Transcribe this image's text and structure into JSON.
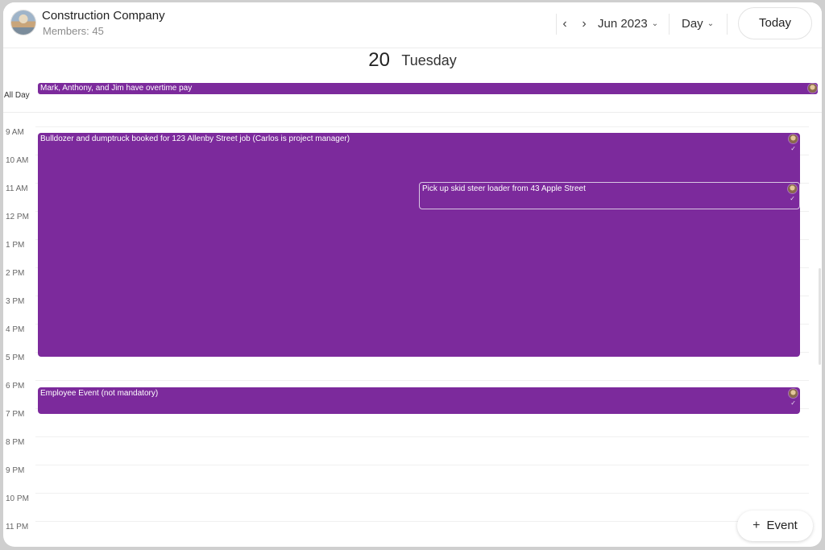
{
  "group": {
    "name": "Construction Company",
    "members": "Members: 45"
  },
  "nav": {
    "prev_icon": "chevron-left-icon",
    "next_icon": "chevron-right-icon",
    "month": "Jun 2023",
    "view": "Day",
    "today": "Today"
  },
  "day": {
    "number": "20",
    "name": "Tuesday"
  },
  "allday": {
    "label": "All Day",
    "event": "Mark, Anthony, and Jim have overtime pay"
  },
  "hours": [
    "9 AM",
    "10 AM",
    "11 AM",
    "12 PM",
    "1 PM",
    "2 PM",
    "3 PM",
    "4 PM",
    "5 PM",
    "6 PM",
    "7 PM",
    "8 PM",
    "9 PM",
    "10 PM",
    "11 PM"
  ],
  "events": [
    {
      "title": "Bulldozer and dumptruck booked for 123 Allenby Street job (Carlos is project manager)"
    },
    {
      "title": "Pick up skid steer loader from 43 Apple Street"
    },
    {
      "title": "Employee Event (not mandatory)"
    }
  ],
  "fab": {
    "label": "Event",
    "icon": "plus-icon"
  },
  "colors": {
    "event": "#7c2a9c"
  }
}
